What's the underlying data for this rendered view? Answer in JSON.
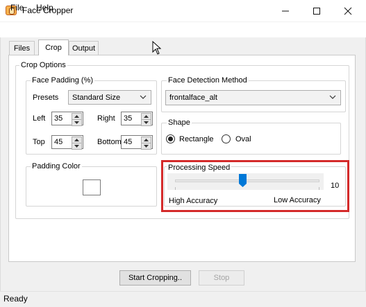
{
  "window": {
    "title": "Face Cropper",
    "controls": {
      "minimize_icon": "minimize-icon",
      "maximize_icon": "maximize-icon",
      "close_icon": "close-icon"
    }
  },
  "menu": {
    "file": "File",
    "help": "Help"
  },
  "tabs": {
    "files": "Files",
    "crop": "Crop",
    "output": "Output",
    "active": "Crop"
  },
  "crop_options": {
    "legend": "Crop Options",
    "face_padding": {
      "legend": "Face Padding (%)",
      "presets_label": "Presets",
      "presets_value": "Standard Size",
      "left_label": "Left",
      "left_value": "35",
      "right_label": "Right",
      "right_value": "35",
      "top_label": "Top",
      "top_value": "45",
      "bottom_label": "Bottom",
      "bottom_value": "45"
    },
    "detection": {
      "legend": "Face Detection Method",
      "value": "frontalface_alt"
    },
    "shape": {
      "legend": "Shape",
      "rectangle": "Rectangle",
      "oval": "Oval",
      "selected": "Rectangle"
    },
    "padding_color": {
      "legend": "Padding Color",
      "color": "#ffffff"
    },
    "processing_speed": {
      "legend": "Processing Speed",
      "value": "10",
      "position_fraction": 0.47,
      "min_label": "High Accuracy",
      "max_label": "Low Accuracy"
    }
  },
  "buttons": {
    "start": "Start Cropping..",
    "stop": "Stop"
  },
  "status": "Ready",
  "colors": {
    "accent": "#0078d7",
    "highlight": "#d42a2a"
  }
}
